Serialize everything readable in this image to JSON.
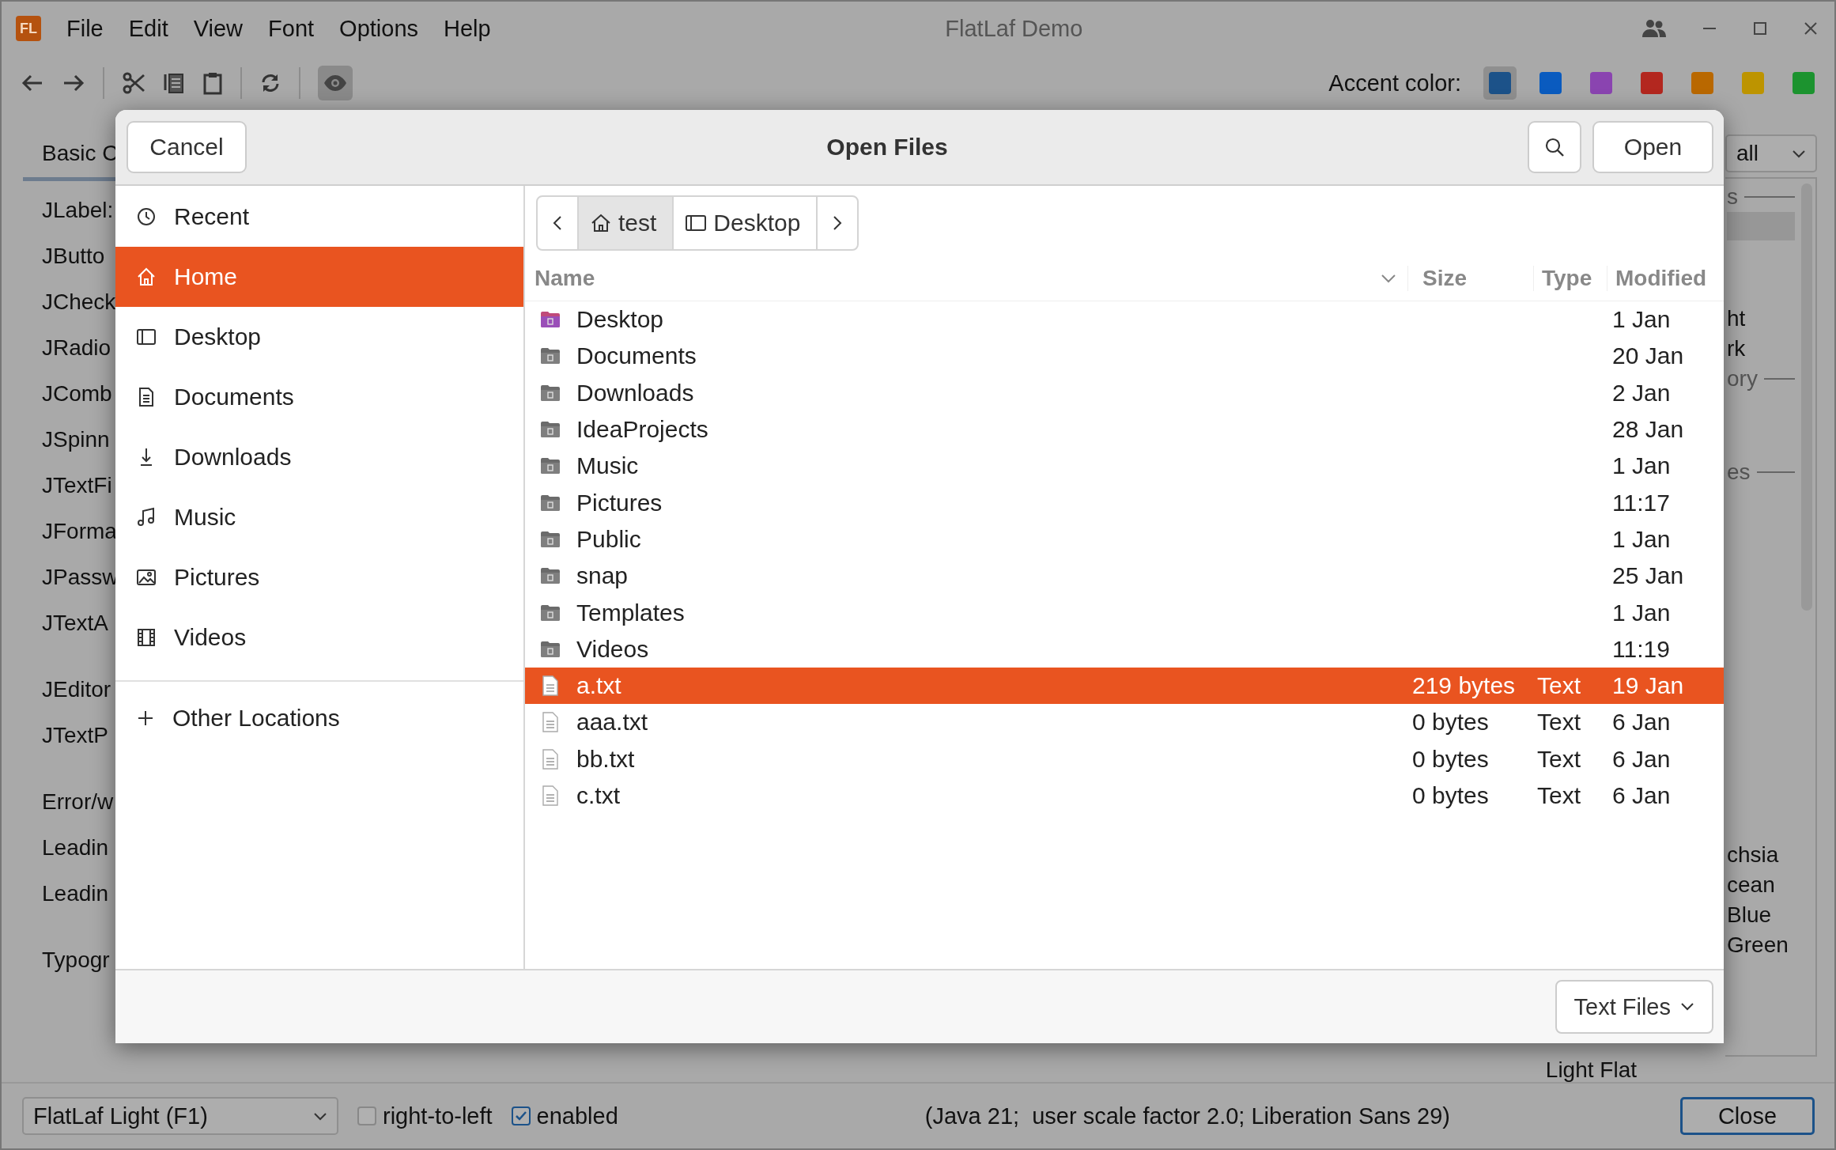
{
  "window": {
    "logo": "FL",
    "title": "FlatLaf Demo"
  },
  "menu": [
    "File",
    "Edit",
    "View",
    "Font",
    "Options",
    "Help"
  ],
  "toolbar_toggle": {
    "selected": true
  },
  "accent": {
    "label": "Accent color:",
    "swatches": [
      {
        "color": "#1c5289",
        "selected": true
      },
      {
        "color": "#0a5bbf",
        "selected": false
      },
      {
        "color": "#8a44b0",
        "selected": false
      },
      {
        "color": "#b3271f",
        "selected": false
      },
      {
        "color": "#b96800",
        "selected": false
      },
      {
        "color": "#bd9400",
        "selected": false
      },
      {
        "color": "#1c932f",
        "selected": false
      }
    ]
  },
  "tab": {
    "label": "Basic C",
    "selected": true
  },
  "components": [
    [
      "JLabel:",
      "JButto",
      "JCheck",
      "JRadio",
      "JComb",
      "JSpinn",
      "JTextFi",
      "JForma",
      "JPassw",
      "JTextA"
    ],
    [
      "JEditor",
      "JTextP"
    ],
    [
      "Error/w",
      "Leadin",
      "Leadin"
    ],
    [
      "Typogr"
    ]
  ],
  "right_panel": {
    "filter": "all",
    "items": [
      {
        "kind": "header",
        "text": "s"
      },
      {
        "kind": "selected-row"
      },
      {
        "kind": "spacer"
      },
      {
        "kind": "item",
        "text": "ht"
      },
      {
        "kind": "item",
        "text": "rk"
      },
      {
        "kind": "header",
        "text": "ory"
      },
      {
        "kind": "spacer"
      },
      {
        "kind": "header",
        "text": "es"
      }
    ],
    "bottom_items": [
      "chsia",
      "cean",
      "Blue",
      "Green"
    ],
    "below": "Light Flat"
  },
  "bottom_bar": {
    "theme": "FlatLaf Light (F1)",
    "checkboxes": [
      {
        "label": "right-to-left",
        "checked": false
      },
      {
        "label": "enabled",
        "checked": true
      }
    ],
    "info": "(Java 21;  user scale factor 2.0; Liberation Sans 29)",
    "close": "Close"
  },
  "dialog": {
    "title": "Open Files",
    "cancel": "Cancel",
    "open": "Open",
    "places": [
      {
        "label": "Recent",
        "selected": false
      },
      {
        "label": "Home",
        "selected": true
      },
      {
        "label": "Desktop",
        "selected": false
      },
      {
        "label": "Documents",
        "selected": false
      },
      {
        "label": "Downloads",
        "selected": false
      },
      {
        "label": "Music",
        "selected": false
      },
      {
        "label": "Pictures",
        "selected": false
      },
      {
        "label": "Videos",
        "selected": false
      }
    ],
    "other_locations": "Other Locations",
    "path": [
      {
        "label": "test",
        "selected": true
      },
      {
        "label": "Desktop",
        "selected": false
      }
    ],
    "columns": [
      "Name",
      "Size",
      "Type",
      "Modified"
    ],
    "files": [
      {
        "kind": "folder",
        "name": "Desktop",
        "modified": "1 Jan",
        "selected": false
      },
      {
        "kind": "folder",
        "name": "Documents",
        "modified": "20 Jan",
        "selected": false
      },
      {
        "kind": "folder",
        "name": "Downloads",
        "modified": "2 Jan",
        "selected": false
      },
      {
        "kind": "folder",
        "name": "IdeaProjects",
        "modified": "28 Jan",
        "selected": false
      },
      {
        "kind": "folder",
        "name": "Music",
        "modified": "1 Jan",
        "selected": false
      },
      {
        "kind": "folder",
        "name": "Pictures",
        "modified": "11:17",
        "selected": false
      },
      {
        "kind": "folder",
        "name": "Public",
        "modified": "1 Jan",
        "selected": false
      },
      {
        "kind": "folder",
        "name": "snap",
        "modified": "25 Jan",
        "selected": false
      },
      {
        "kind": "folder",
        "name": "Templates",
        "modified": "1 Jan",
        "selected": false
      },
      {
        "kind": "folder",
        "name": "Videos",
        "modified": "11:19",
        "selected": false
      },
      {
        "kind": "file",
        "name": "a.txt",
        "size": "219 bytes",
        "type": "Text",
        "modified": "19 Jan",
        "selected": true
      },
      {
        "kind": "file",
        "name": "aaa.txt",
        "size": "0 bytes",
        "type": "Text",
        "modified": "6 Jan",
        "selected": false
      },
      {
        "kind": "file",
        "name": "bb.txt",
        "size": "0 bytes",
        "type": "Text",
        "modified": "6 Jan",
        "selected": false
      },
      {
        "kind": "file",
        "name": "c.txt",
        "size": "0 bytes",
        "type": "Text",
        "modified": "6 Jan",
        "selected": false
      }
    ],
    "filter": "Text Files"
  }
}
